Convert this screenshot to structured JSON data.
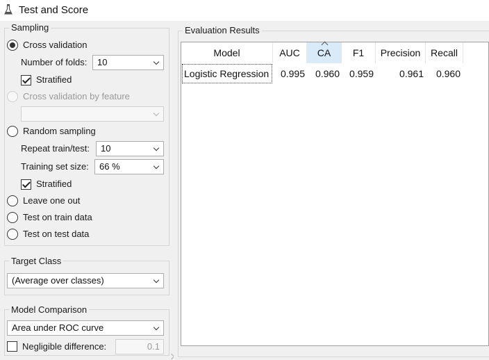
{
  "window": {
    "title": "Test and Score"
  },
  "sampling": {
    "title": "Sampling",
    "cross_validation": {
      "label": "Cross validation",
      "checked": true
    },
    "number_of_folds": {
      "label": "Number of folds:",
      "value": "10"
    },
    "stratified_1": {
      "label": "Stratified",
      "checked": true
    },
    "cross_validation_by_feature": {
      "label": "Cross validation by feature",
      "enabled": false,
      "value": ""
    },
    "random_sampling": {
      "label": "Random sampling",
      "checked": false
    },
    "repeat_train_test": {
      "label": "Repeat train/test:",
      "value": "10"
    },
    "training_set_size": {
      "label": "Training set size:",
      "value": "66 %"
    },
    "stratified_2": {
      "label": "Stratified",
      "checked": true
    },
    "leave_one_out": {
      "label": "Leave one out"
    },
    "test_on_train": {
      "label": "Test on train data"
    },
    "test_on_test": {
      "label": "Test on test data"
    }
  },
  "target_class": {
    "title": "Target Class",
    "value": "(Average over classes)"
  },
  "model_comparison": {
    "title": "Model Comparison",
    "metric": "Area under ROC curve",
    "negligible_label": "Negligible difference:",
    "negligible_value": "0.1",
    "negligible_checked": false
  },
  "evaluation": {
    "title": "Evaluation Results",
    "columns": [
      "Model",
      "AUC",
      "CA",
      "F1",
      "Precision",
      "Recall"
    ],
    "sorted_column": "CA",
    "rows": [
      {
        "model": "Logistic Regression",
        "auc": "0.995",
        "ca": "0.960",
        "f1": "0.959",
        "precision": "0.961",
        "recall": "0.960"
      }
    ]
  },
  "icons": {
    "window": "flask-icon",
    "dropdown": "chevron-down-icon",
    "sort": "sort-caret-icon"
  }
}
